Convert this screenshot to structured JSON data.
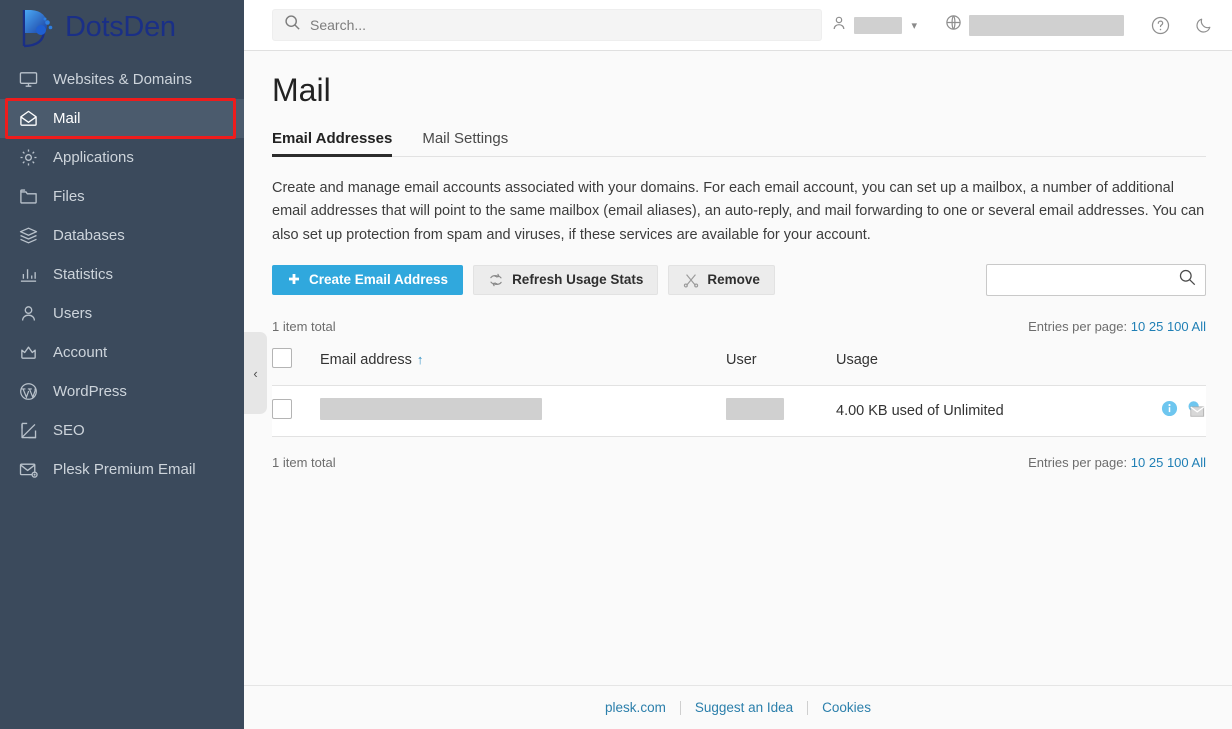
{
  "brand": {
    "name": "DotsDen",
    "logo_icon": "dotsden-logo-icon",
    "text_color": "#1a2f86",
    "accent": "#2f7fe0"
  },
  "sidebar": {
    "items": [
      {
        "label": "Websites & Domains",
        "icon": "monitor-icon",
        "active": false
      },
      {
        "label": "Mail",
        "icon": "envelope-open-icon",
        "active": true,
        "highlighted": true
      },
      {
        "label": "Applications",
        "icon": "gear-icon",
        "active": false
      },
      {
        "label": "Files",
        "icon": "folder-icon",
        "active": false
      },
      {
        "label": "Databases",
        "icon": "database-stack-icon",
        "active": false
      },
      {
        "label": "Statistics",
        "icon": "bar-chart-icon",
        "active": false
      },
      {
        "label": "Users",
        "icon": "user-icon",
        "active": false
      },
      {
        "label": "Account",
        "icon": "crown-icon",
        "active": false
      },
      {
        "label": "WordPress",
        "icon": "wordpress-icon",
        "active": false
      },
      {
        "label": "SEO",
        "icon": "seo-arrow-icon",
        "active": false
      },
      {
        "label": "Plesk Premium Email",
        "icon": "premium-mail-icon",
        "active": false
      }
    ],
    "highlight_color": "#ee1c1c",
    "background": "#3b4a5c"
  },
  "topbar": {
    "search": {
      "placeholder": "Search...",
      "value": "",
      "icon": "search-icon"
    },
    "user": {
      "icon": "user-icon",
      "name_redacted": true,
      "chevron": "chevron-down-icon"
    },
    "locale": {
      "icon": "globe-icon",
      "value_redacted": true
    },
    "help": {
      "icon": "help-circle-icon",
      "label": "?"
    },
    "theme": {
      "icon": "moon-icon"
    }
  },
  "page": {
    "title": "Mail",
    "tabs": [
      {
        "label": "Email Addresses",
        "active": true
      },
      {
        "label": "Mail Settings",
        "active": false
      }
    ],
    "description": "Create and manage email accounts associated with your domains. For each email account, you can set up a mailbox, a number of additional email addresses that will point to the same mailbox (email aliases), an auto-reply, and mail forwarding to one or several email addresses. You can also set up protection from spam and viruses, if these services are available for your account."
  },
  "toolbar": {
    "create_label": "Create Email Address",
    "create_icon": "plus-icon",
    "refresh_label": "Refresh Usage Stats",
    "refresh_icon": "refresh-icon",
    "remove_label": "Remove",
    "remove_icon": "scissors-x-icon",
    "primary_color": "#30a8dd"
  },
  "list_search": {
    "placeholder": "",
    "value": "",
    "icon": "search-icon"
  },
  "pagination": {
    "total_label": "1 item total",
    "entries_label": "Entries per page:",
    "options": [
      "10",
      "25",
      "100",
      "All"
    ]
  },
  "table": {
    "columns": [
      {
        "key": "email",
        "label": "Email address",
        "sorted": true,
        "sort_icon": "sort-asc-arrow"
      },
      {
        "key": "user",
        "label": "User"
      },
      {
        "key": "usage",
        "label": "Usage"
      }
    ],
    "rows": [
      {
        "email_redacted": true,
        "user_redacted": true,
        "usage": "4.00 KB used of Unlimited",
        "actions": [
          {
            "icon": "info-circle-icon",
            "name": "info-icon"
          },
          {
            "icon": "webmail-envelope-icon",
            "name": "webmail-icon"
          }
        ]
      }
    ]
  },
  "collapse": {
    "icon": "chevron-left-icon",
    "glyph": "‹"
  },
  "footer": {
    "links": [
      "plesk.com",
      "Suggest an Idea",
      "Cookies"
    ]
  }
}
